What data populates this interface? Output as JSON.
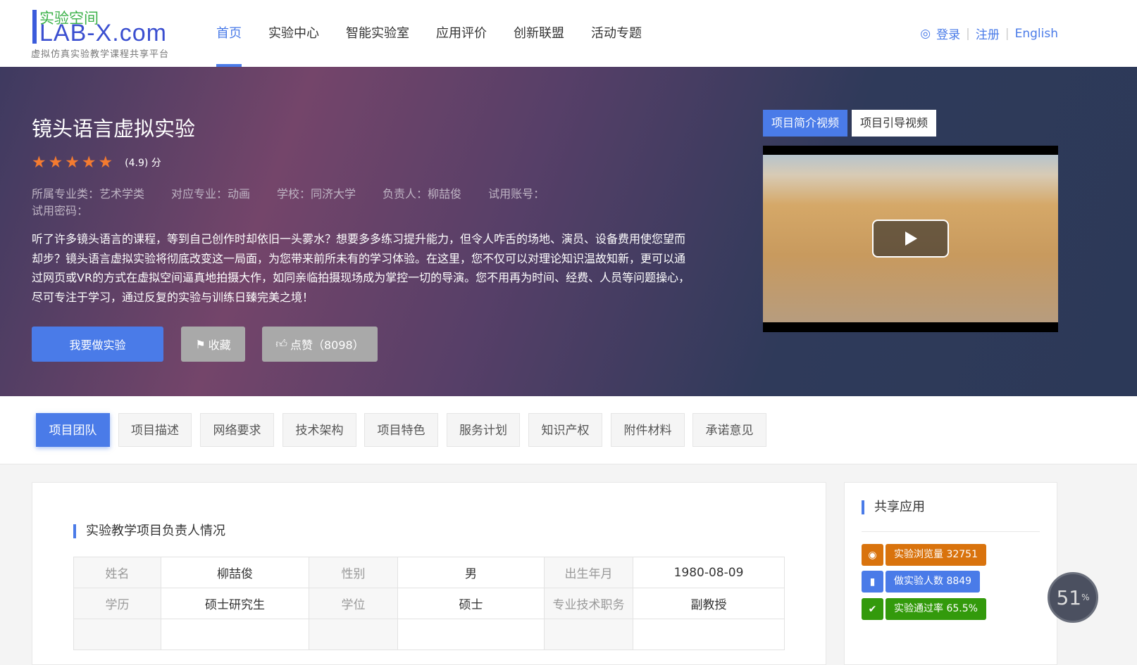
{
  "logo": {
    "cn": "实验空间",
    "en": "LAB-X.com",
    "sub": "虚拟仿真实验教学课程共享平台"
  },
  "nav": [
    "首页",
    "实验中心",
    "智能实验室",
    "应用评价",
    "创新联盟",
    "活动专题"
  ],
  "auth": {
    "login": "登录",
    "register": "注册",
    "lang": "English"
  },
  "hero": {
    "title": "镜头语言虚拟实验",
    "rating_value": 4.9,
    "score": "(4.9) 分",
    "meta": [
      "所属专业类：艺术学类",
      "对应专业：动画",
      "学校：同济大学",
      "负责人：柳喆俊",
      "试用账号：",
      "试用密码："
    ],
    "desc": "听了许多镜头语言的课程，等到自己创作时却依旧一头雾水？想要多多练习提升能力，但令人咋舌的场地、演员、设备费用使您望而却步？镜头语言虚拟实验将彻底改变这一局面，为您带来前所未有的学习体验。在这里，您不仅可以对理论知识温故知新，更可以通过网页或VR的方式在虚拟空间逼真地拍摄大作，如同亲临拍摄现场成为掌控一切的导演。您不用再为时间、经费、人员等问题操心，尽可专注于学习，通过反复的实验与训练日臻完美之境！",
    "do_btn": "我要做实验",
    "fav_btn": "收藏",
    "like_btn": "点赞（8098）",
    "video_tabs": [
      "项目简介视频",
      "项目引导视频"
    ]
  },
  "tabs": [
    "项目团队",
    "项目描述",
    "网络要求",
    "技术架构",
    "项目特色",
    "服务计划",
    "知识产权",
    "附件材料",
    "承诺意见"
  ],
  "section": {
    "title": "实验教学项目负责人情况",
    "rows": [
      [
        "姓名",
        "柳喆俊",
        "性别",
        "男",
        "出生年月",
        "1980-08-09"
      ],
      [
        "学历",
        "硕士研究生",
        "学位",
        "硕士",
        "专业技术职务",
        "副教授"
      ]
    ]
  },
  "side": {
    "title": "共享应用",
    "stats": [
      {
        "label": "实验浏览量 32751",
        "color": "#d9730d"
      },
      {
        "label": "做实验人数 8849",
        "color": "#4a7be8"
      },
      {
        "label": "实验通过率 65.5%",
        "color": "#339a0c"
      }
    ]
  },
  "gauge": "51"
}
